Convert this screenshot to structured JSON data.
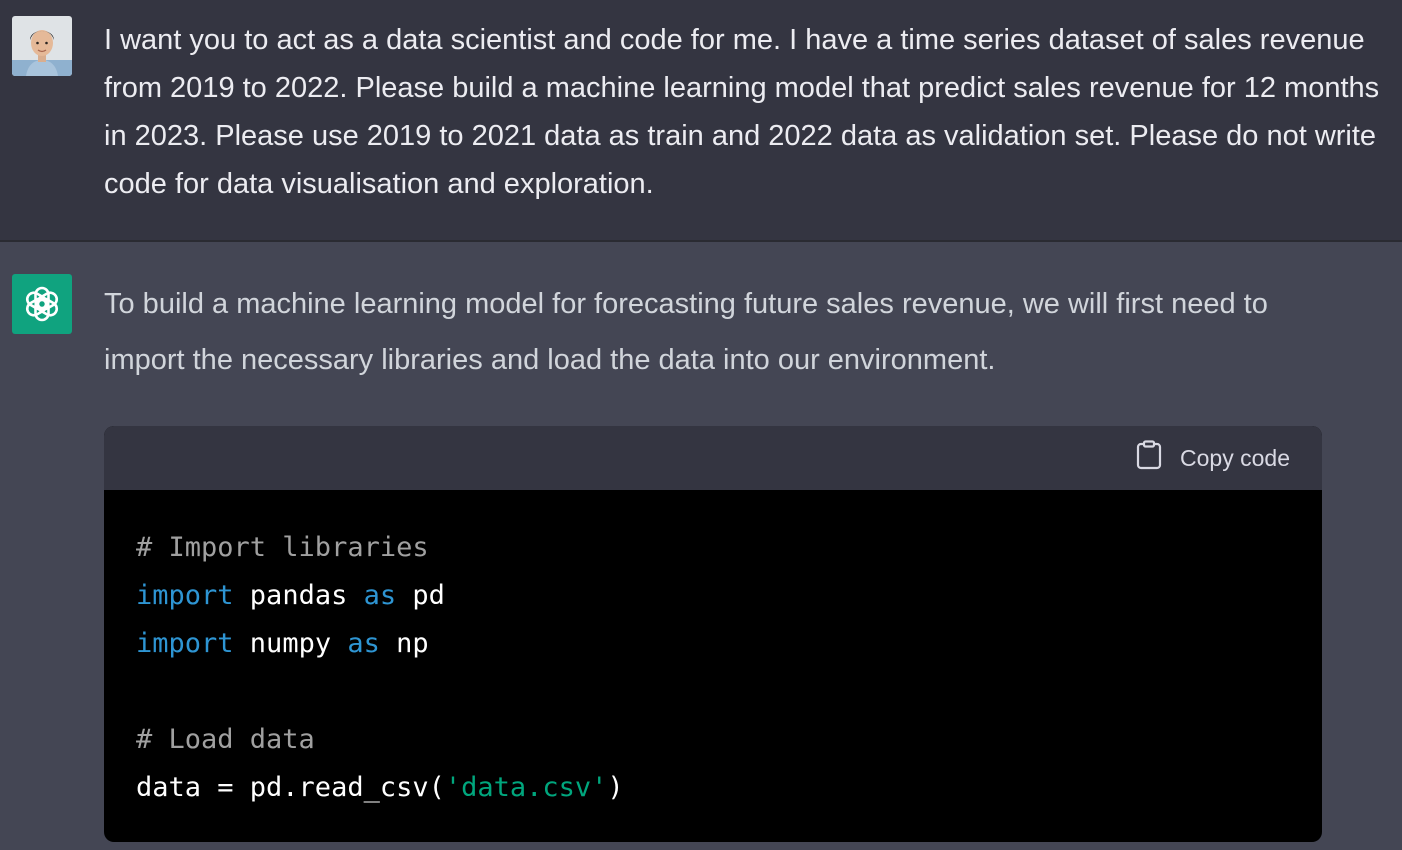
{
  "user_message": {
    "text": "I want you to act as a data scientist and code for me. I have a time series dataset of sales revenue from 2019 to 2022. Please build a machine learning model that predict sales revenue for 12 months in 2023. Please use 2019 to 2021 data as train and 2022 data as validation set. Please do not write code for data visualisation and exploration."
  },
  "assistant_message": {
    "text": "To build a machine learning model for forecasting future sales revenue, we will first need to import the necessary libraries and load the data into our environment.",
    "code_block": {
      "copy_label": "Copy code",
      "lines": {
        "comment_import": "# Import libraries",
        "import_kw_1": "import",
        "pandas": " pandas ",
        "as_kw_1": "as",
        "pd": " pd",
        "import_kw_2": "import",
        "numpy": " numpy ",
        "as_kw_2": "as",
        "np": " np",
        "comment_load": "# Load data",
        "data_assign": "data = pd.read_csv(",
        "csv_str": "'data.csv'",
        "close_paren": ")"
      }
    }
  },
  "colors": {
    "user_bg": "#343541",
    "assistant_bg": "#444654",
    "gpt_brand": "#10a37f",
    "keyword": "#2e95d3",
    "string": "#00a67d",
    "comment": "#a0a0a0"
  },
  "icons": [
    "user-avatar",
    "openai-logo-icon",
    "clipboard-icon"
  ]
}
